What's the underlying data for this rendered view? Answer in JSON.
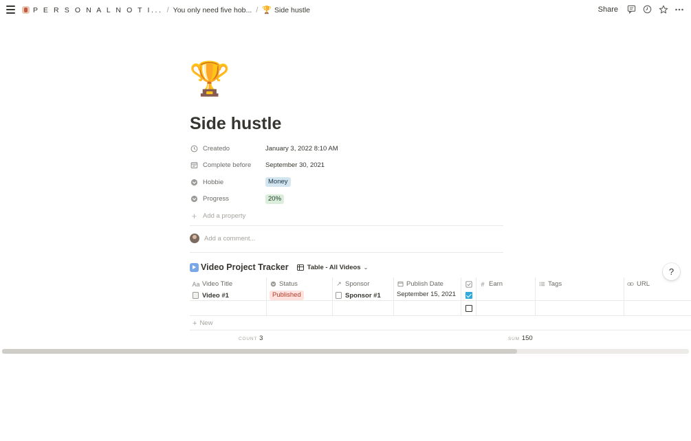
{
  "breadcrumbs": {
    "workspace": "P E R S O N A L N O T I...",
    "parent": "You only need five hob...",
    "current_icon": "🏆",
    "current": "Side hustle"
  },
  "toolbar": {
    "share_label": "Share",
    "icons": [
      "comment-icon",
      "clock-icon",
      "star-icon",
      "more-icon"
    ]
  },
  "page": {
    "icon": "🏆",
    "title": "Side hustle"
  },
  "properties": [
    {
      "name": "Createdo",
      "value": "January 3, 2022 8:10 AM",
      "icon": "clock-icon",
      "kind": "text"
    },
    {
      "name": "Complete before",
      "value": "September 30, 2021",
      "icon": "calendar-icon",
      "kind": "text"
    },
    {
      "name": "Hobbie",
      "value": "Money",
      "icon": "select-icon",
      "kind": "tag",
      "color": "#d3e5ef"
    },
    {
      "name": "Progress",
      "value": "20%",
      "icon": "select-icon",
      "kind": "tag",
      "color": "#dbeddb"
    }
  ],
  "add_property_label": "Add a property",
  "comment_placeholder": "Add a comment...",
  "database": {
    "title": "Video Project Tracker",
    "view_label": "Table - All Videos",
    "columns": [
      {
        "label": "Video Title",
        "icon": "Aa"
      },
      {
        "label": "Status",
        "icon": "select-icon"
      },
      {
        "label": "Sponsor",
        "icon": "relation-arrow-icon"
      },
      {
        "label": "Publish Date",
        "icon": "calendar-icon"
      },
      {
        "label": "",
        "icon": "checkbox-icon"
      },
      {
        "label": "Earn",
        "icon": "#"
      },
      {
        "label": "Tags",
        "icon": "list-icon"
      },
      {
        "label": "URL",
        "icon": "link-icon"
      }
    ],
    "rows": [
      {
        "title": "Video #1",
        "status": "Published",
        "sponsor": "Sponsor #1",
        "publish_date": "September 15, 2021",
        "checked": true,
        "earn": "",
        "tags": "",
        "url": ""
      },
      {
        "title": "",
        "status": "",
        "sponsor": "",
        "publish_date": "",
        "checked": false,
        "earn": "",
        "tags": "",
        "url": ""
      }
    ],
    "new_label": "New",
    "count_label": "COUNT",
    "count_value": "3",
    "sum_label": "SUM",
    "sum_value": "150",
    "scroll_fraction": 0.75
  },
  "help_label": "?",
  "colors": {
    "text": "#37352f",
    "accent_checkbox": "#2eaadc",
    "status_published_bg": "#ffe2dd",
    "status_published_fg": "#b23b2c"
  }
}
